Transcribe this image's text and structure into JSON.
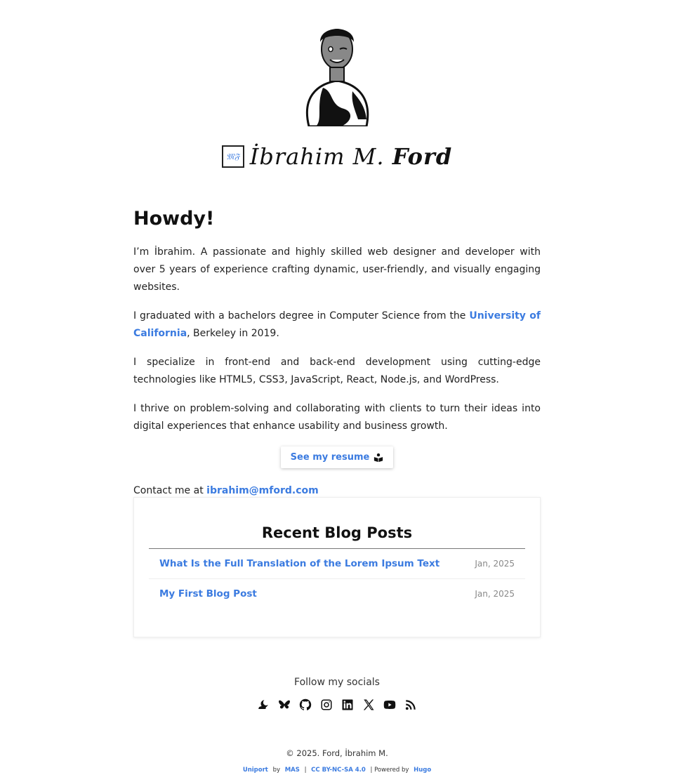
{
  "header": {
    "logo_mark": "𝔐𝔉",
    "name_first": "İbrahim M.",
    "name_last": "Ford"
  },
  "intro": {
    "heading": "Howdy!",
    "p1": "I’m İbrahim. A passionate and highly skilled web designer and developer with over 5 years of experience crafting dynamic, user-friendly, and visually engaging websites.",
    "p2_before": "I graduated with a bachelors degree in Computer Science from the ",
    "p2_link": "University of California",
    "p2_after": ", Berkeley in 2019.",
    "p3": "I specialize in front-end and back-end development using cutting-edge technologies like HTML5, CSS3, JavaScript, React, Node.js, and WordPress.",
    "p4": "I thrive on problem-solving and collaborating with clients to turn their ideas into digital experiences that enhance usability and business growth.",
    "resume_button": "See my resume",
    "contact_prefix": "Contact me at ",
    "contact_email": "ibrahim@mford.com"
  },
  "blog": {
    "title": "Recent Blog Posts",
    "posts": [
      {
        "title": "What Is the Full Translation of the Lorem Ipsum Text",
        "date": "Jan, 2025"
      },
      {
        "title": "My First Blog Post",
        "date": "Jan, 2025"
      }
    ]
  },
  "socials": {
    "label": "Follow my socials",
    "icons": [
      "weather-cloud-moon-icon",
      "bluesky-icon",
      "github-icon",
      "instagram-icon",
      "linkedin-icon",
      "x-icon",
      "youtube-icon",
      "rss-icon"
    ]
  },
  "footer": {
    "copyright": "© 2025. Ford, İbrahim M.",
    "theme": "Uniport",
    "by": "by",
    "author": "MAS",
    "sep": "|",
    "license": "CC BY-NC-SA 4.0",
    "powered": "| Powered by",
    "engine": "Hugo"
  },
  "colors": {
    "link": "#3b7be0",
    "text": "#222222"
  }
}
